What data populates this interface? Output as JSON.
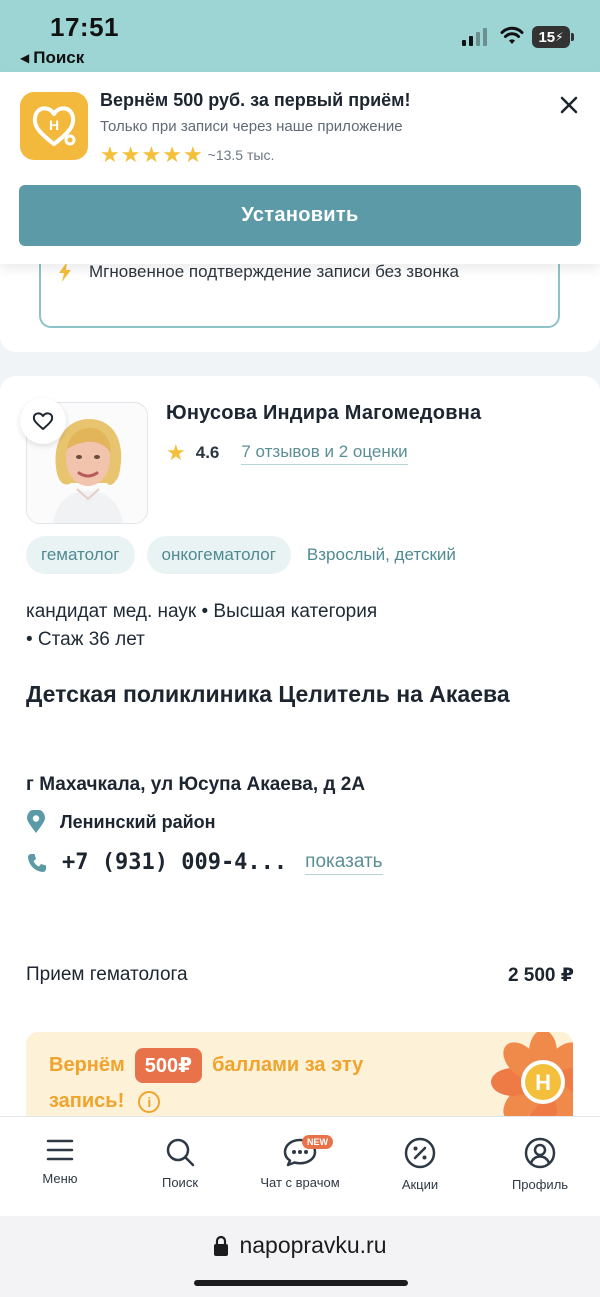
{
  "status_bar": {
    "time": "17:51",
    "back_label": "Поиск",
    "battery": "15"
  },
  "app_banner": {
    "title": "Вернём 500 руб. за первый приём!",
    "subtitle": "Только при записи через наше приложение",
    "stars": 5,
    "rating_count": "~13.5 тыс.",
    "install_label": "Установить",
    "logo_letter": "Н"
  },
  "prev_card": {
    "text": "Мгновенное подтверждение записи без звонка"
  },
  "doctor": {
    "name": "Юнусова Индира Магомедовна",
    "rating": "4.6",
    "reviews": "7 отзывов и 2 оценки",
    "tags": [
      "гематолог",
      "онкогематолог"
    ],
    "age_group": "Взрослый, детский",
    "degree_line1": "кандидат мед. наук •  Высшая категория",
    "degree_line2": " •  Стаж 36 лет",
    "clinic": "Детская поликлиника Целитель на Акаева",
    "address": "г Махачкала, ул Юсупа Акаева, д 2А",
    "district": "Ленинский район",
    "phone": "+7 (931) 009-4...",
    "show_phone": "показать",
    "service": "Прием гематолога",
    "price": "2 500 ₽"
  },
  "cashback": {
    "text_before": "Вернём",
    "badge": "500₽",
    "text_after": "баллами за эту",
    "line2": "запись!",
    "logo_letter": "Н"
  },
  "bottom_nav": {
    "items": [
      {
        "label": "Меню",
        "icon": "menu-icon"
      },
      {
        "label": "Поиск",
        "icon": "search-icon"
      },
      {
        "label": "Чат с врачом",
        "icon": "chat-icon",
        "badge": "NEW"
      },
      {
        "label": "Акции",
        "icon": "percent-icon"
      },
      {
        "label": "Профиль",
        "icon": "profile-icon"
      }
    ]
  },
  "browser": {
    "url": "napopravku.ru"
  },
  "colors": {
    "teal": "#5b9aa6",
    "accent_orange": "#e8734a",
    "star": "#f4bf3a",
    "status_bg": "#9dd4d4"
  }
}
